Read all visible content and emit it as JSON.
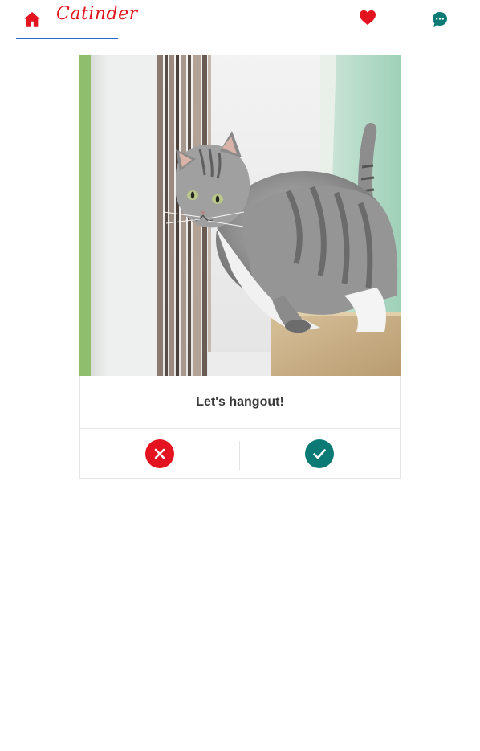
{
  "header": {
    "brand_name": "Catinder",
    "active_tab": "home",
    "colors": {
      "brand": "#e3141f",
      "active_underline": "#1f67c9",
      "chat": "#0b7a75"
    },
    "icons": {
      "home": "home-icon",
      "likes": "heart-icon",
      "messages": "chat-bubble-icon"
    }
  },
  "card": {
    "photo_subject": "cat",
    "caption": "Let's hangout!",
    "actions": {
      "reject_icon": "close-icon",
      "accept_icon": "check-icon",
      "reject_color": "#e3141f",
      "accept_color": "#0b7a75"
    }
  }
}
